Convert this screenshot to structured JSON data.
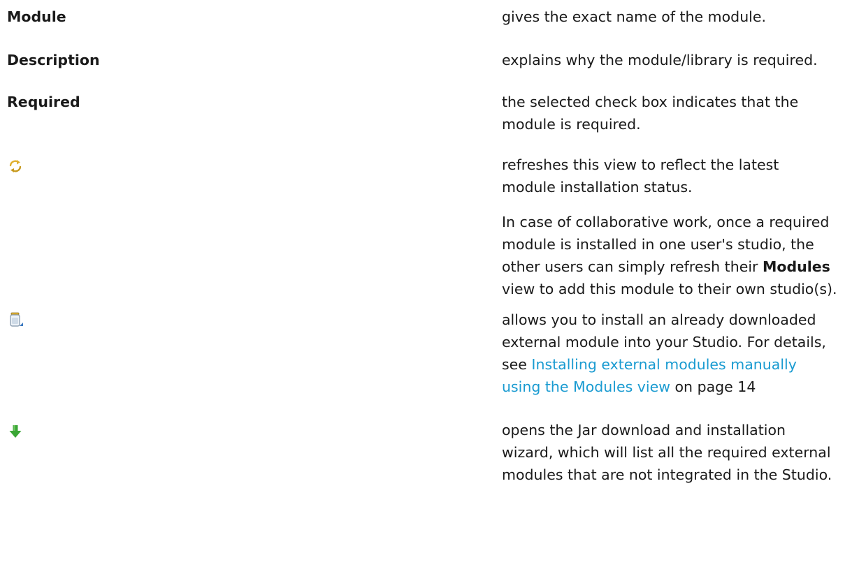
{
  "rows": [
    {
      "term": "Module",
      "description": "gives the exact name of the module."
    },
    {
      "term": "Description",
      "description": "explains why the module/library is required."
    },
    {
      "term": "Required",
      "description_line1": "the selected check box indicates that the",
      "description_line2": "module is required."
    },
    {
      "icon": "refresh-icon",
      "description_line1": "refreshes this view to reflect the latest",
      "description_line2": "module installation status.",
      "note_line1": "In case of collaborative work, once a required",
      "note_line2": "module is installed in one user's studio, the",
      "note_line3_pre": "other users can simply refresh their ",
      "note_line3_bold": "Modules",
      "note_line4": "view to add this module to their own studio(s)."
    },
    {
      "icon": "jar-install-icon",
      "description_line1": "allows you to install an already downloaded",
      "description_line2": "external module into your Studio. For details,",
      "description_line3_pre": "see ",
      "link_line1": "Installing external modules manually",
      "link_line2": "using the Modules view",
      "page_ref": " on page 14"
    },
    {
      "icon": "download-arrow-icon",
      "description_line1": "opens the Jar download and installation",
      "description_line2": "wizard, which will list all the required external",
      "description_line3": "modules that are not integrated in the Studio."
    }
  ],
  "colors": {
    "text": "#1a1a1a",
    "link": "#1a9bd1",
    "refresh_icon": "#e0b030",
    "jar_icon": "#9fb3c8",
    "download_icon": "#3aa635"
  }
}
